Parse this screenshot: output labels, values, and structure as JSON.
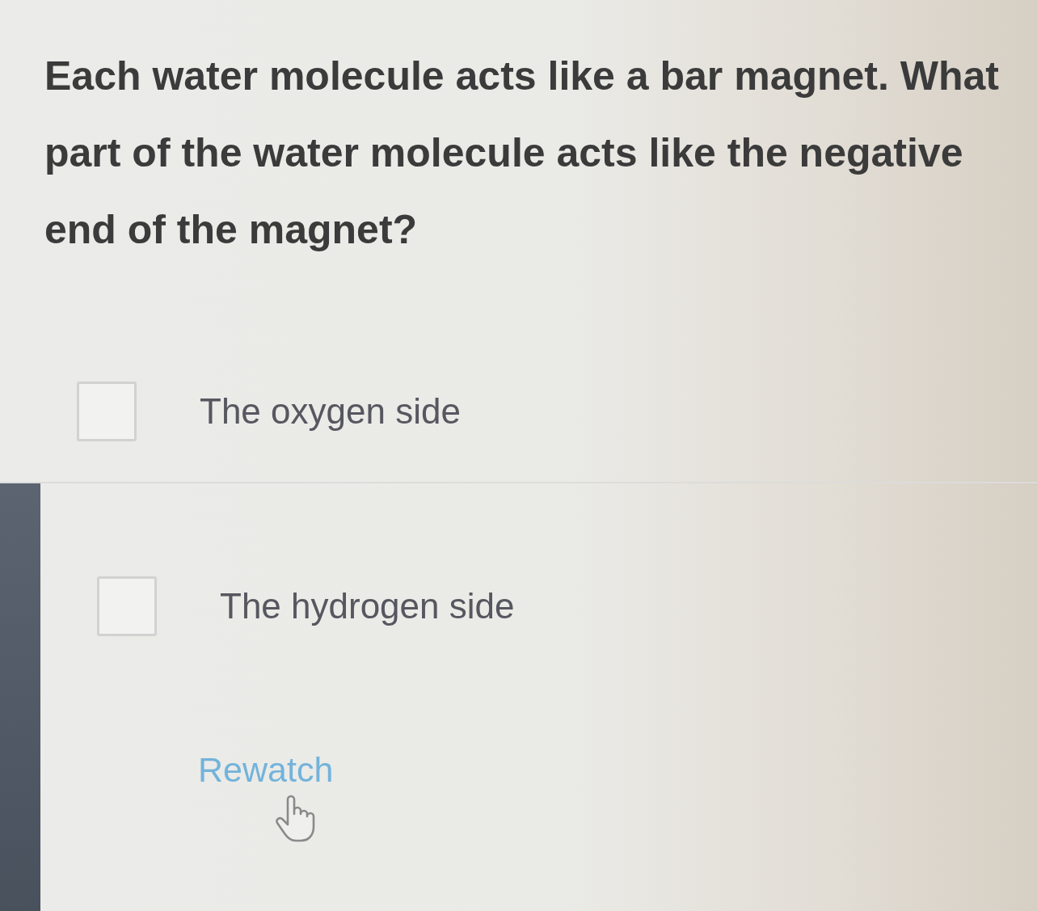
{
  "question": {
    "text": "Each water molecule acts like a bar magnet. What part of the water molecule acts like the negative end of the magnet?"
  },
  "options": [
    {
      "label": "The oxygen side",
      "checked": false
    },
    {
      "label": "The hydrogen side",
      "checked": false
    }
  ],
  "rewatch": {
    "label": "Rewatch"
  }
}
